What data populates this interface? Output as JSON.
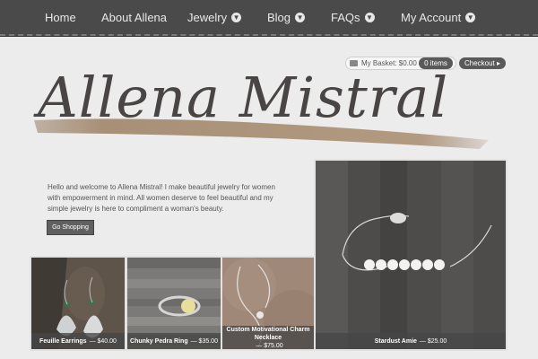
{
  "nav": {
    "items": [
      {
        "label": "Home",
        "dropdown": false
      },
      {
        "label": "About Allena",
        "dropdown": false
      },
      {
        "label": "Jewelry",
        "dropdown": true
      },
      {
        "label": "Blog",
        "dropdown": true
      },
      {
        "label": "FAQs",
        "dropdown": true
      },
      {
        "label": "My Account",
        "dropdown": true
      }
    ]
  },
  "cart": {
    "label": "My Basket: $0.00",
    "items": "0 items",
    "checkout": "Checkout ▸"
  },
  "logo": {
    "text": "Allena Mistral"
  },
  "intro": {
    "text": "Hello and welcome to Allena Mistral! I make beautiful jewelry for women with empowerment in mind. All women deserve to feel beautiful and my simple jewelry is here to compliment a woman's beauty.",
    "button": "Go Shopping"
  },
  "products": [
    {
      "name": "Feuille Earrings",
      "price": "— $40.00"
    },
    {
      "name": "Chunky Pedra Ring",
      "price": "— $35.00"
    },
    {
      "name": "Custom Motivational Charm Necklace",
      "price": "— $75.00"
    },
    {
      "name": "Stardust Amie",
      "price": "— $25.00"
    }
  ],
  "colors": {
    "nav_bg": "#4a4a4a",
    "page_bg": "#ececec",
    "button": "#5a5a5a"
  }
}
